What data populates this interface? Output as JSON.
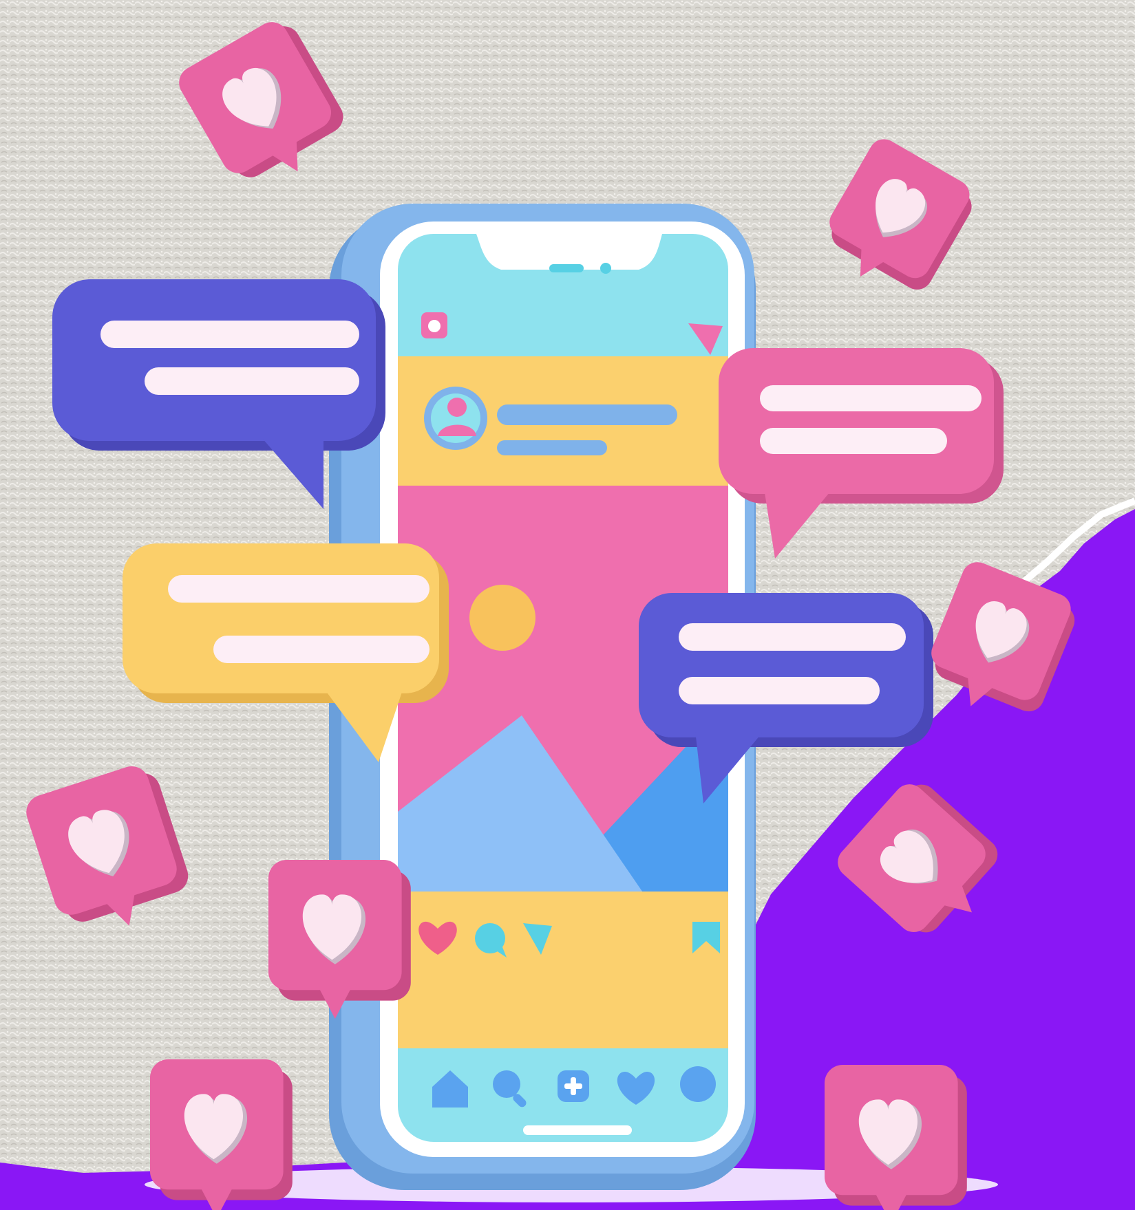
{
  "illustration": {
    "subject": "social-media-phone",
    "colors": {
      "background_texture": "#d8d6d0",
      "accent_purple": "#8a17f5",
      "phone_frame": "#7fb2ea",
      "screen_top_bar": "#8ee2ee",
      "post_header": "#fbd06e",
      "post_image": "#ef6fae",
      "mountain_light": "#8ec0f7",
      "mountain_dark": "#4e9ef0",
      "bubble_blue": "#5b5bd6",
      "bubble_pink": "#eb6aa7",
      "bubble_yellow": "#fbcf6a",
      "like_badge": "#e5619e",
      "heart": "#fbe6f0"
    },
    "icons": [
      "camera-icon",
      "send-icon",
      "avatar-icon",
      "heart-icon",
      "comment-icon",
      "share-icon",
      "bookmark-icon",
      "home-icon",
      "search-icon",
      "add-icon",
      "favorite-icon",
      "profile-icon"
    ]
  }
}
